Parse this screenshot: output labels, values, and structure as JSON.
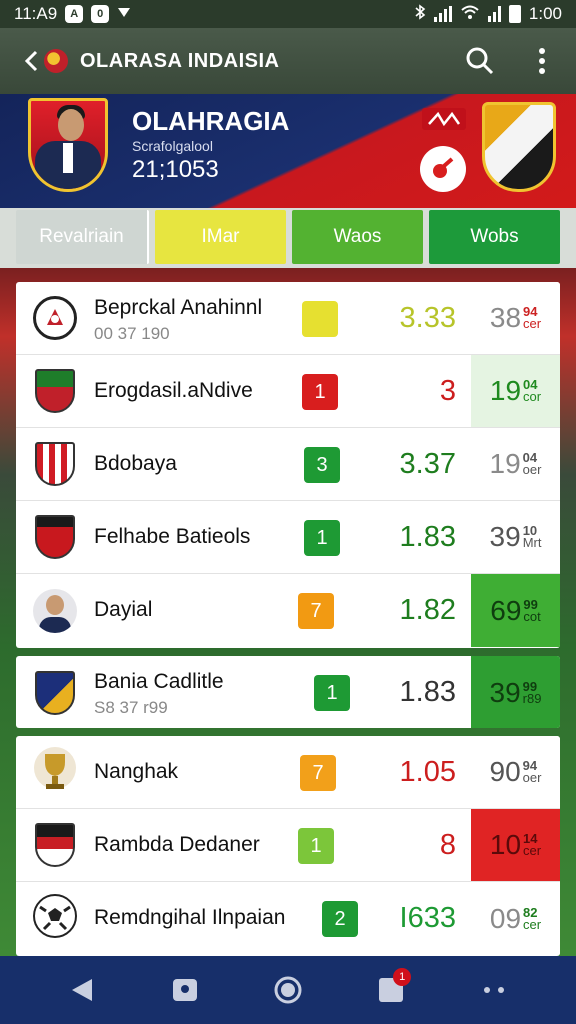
{
  "status_bar": {
    "time": "11:A9",
    "icon_a": "A",
    "icon_b": "0",
    "right_time": "1:00"
  },
  "app_bar": {
    "title": "OLARASA INDAISIA"
  },
  "hero": {
    "title": "OLAHRAGIA",
    "subtitle": "Scrafolgalool",
    "number": "21;1053"
  },
  "tabs": [
    "Revalriain",
    "IMar",
    "Waos",
    "Wobs"
  ],
  "rows": [
    {
      "name": "Beprckal Anahinnl",
      "sub": "00 37 190",
      "badge": "",
      "badge_color": "#e6e030",
      "odd": "3.33",
      "odd_color": "#b7c42a",
      "last_main": "38",
      "last_top": "94",
      "last_bottom": "cer",
      "last_bg": "#ffffff",
      "last_color": "#8a8a8a",
      "last_small_color": "#c22",
      "logo": "round"
    },
    {
      "name": "Erogdasil.aNdive",
      "sub": "",
      "badge": "1",
      "badge_color": "#d81e1e",
      "odd": "3",
      "odd_color": "#cc1e1e",
      "last_main": "19",
      "last_top": "04",
      "last_bottom": "cor",
      "last_bg": "#e5f4e2",
      "last_color": "#1f8a1f",
      "last_small_color": "#1f8a1f",
      "logo": "shield-green"
    },
    {
      "name": "Bdobaya",
      "sub": "",
      "badge": "3",
      "badge_color": "#1e9a34",
      "odd": "3.37",
      "odd_color": "#1e7d1e",
      "last_main": "19",
      "last_top": "04",
      "last_bottom": "oer",
      "last_bg": "#ffffff",
      "last_color": "#8a8a8a",
      "last_small_color": "#555",
      "logo": "shield-red"
    },
    {
      "name": "Felhabe Batieols",
      "sub": "",
      "badge": "1",
      "badge_color": "#1e9a34",
      "odd": "1.83",
      "odd_color": "#1e7d1e",
      "last_main": "39",
      "last_top": "10",
      "last_bottom": "Mrt",
      "last_bg": "#ffffff",
      "last_color": "#555",
      "last_small_color": "#555",
      "logo": "shield-stripe"
    },
    {
      "name": "Dayial",
      "sub": "",
      "badge": "7",
      "badge_color": "#f29a12",
      "odd": "1.82",
      "odd_color": "#1e7d1e",
      "last_main": "69",
      "last_top": "99",
      "last_bottom": "cot",
      "last_bg": "#3fae34",
      "last_color": "#0f3d0f",
      "last_small_color": "#0f3d0f",
      "logo": "person"
    },
    {
      "name": "Bania Cadlitle",
      "sub": "S8 37 r99",
      "badge": "1",
      "badge_color": "#1e9a34",
      "odd": "1.83",
      "odd_color": "#333",
      "last_main": "39",
      "last_top": "99",
      "last_bottom": "r89",
      "last_bg": "#2e9e32",
      "last_color": "#0f3d0f",
      "last_small_color": "#0f3d0f",
      "logo": "shield-blue"
    },
    {
      "name": "Nanghak",
      "sub": "",
      "badge": "7",
      "badge_color": "#f2a01a",
      "odd": "1.05",
      "odd_color": "#cc1e1e",
      "last_main": "90",
      "last_top": "94",
      "last_bottom": "oer",
      "last_bg": "#ffffff",
      "last_color": "#555",
      "last_small_color": "#555",
      "logo": "trophy"
    },
    {
      "name": "Rambda Dedaner",
      "sub": "",
      "badge": "1",
      "badge_color": "#7cc63a",
      "odd": "8",
      "odd_color": "#cc1e1e",
      "last_main": "10",
      "last_top": "14",
      "last_bottom": "cer",
      "last_bg": "#e02424",
      "last_color": "#5a0a0a",
      "last_small_color": "#5a0a0a",
      "logo": "shield-dark"
    },
    {
      "name": "Remdngihal Ilnpaian",
      "sub": "",
      "badge": "2",
      "badge_color": "#1e9a34",
      "odd": "I633",
      "odd_color": "#1e9a34",
      "last_main": "09",
      "last_top": "82",
      "last_bottom": "cer",
      "last_bg": "#ffffff",
      "last_color": "#8a8a8a",
      "last_small_color": "#1e7d1e",
      "logo": "ball"
    }
  ],
  "nav": {
    "notification_count": "1"
  },
  "icons": {
    "back": "back-arrow-icon",
    "search": "search-icon",
    "more": "more-vertical-icon",
    "nav_back": "triangle-back-icon",
    "nav_home": "circle-home-icon"
  },
  "colors": {
    "app_bar": "#394839",
    "hero_blue": "#14245a",
    "hero_red": "#d21a1a",
    "nav_bar": "#172f6a"
  }
}
